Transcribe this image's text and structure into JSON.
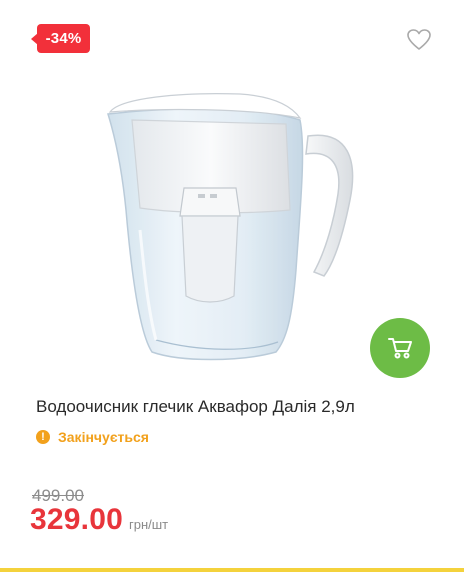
{
  "card": {
    "badge": "-34%",
    "title": "Водоочисник глечик Аквафор Далія 2,9л",
    "status": "Закінчується",
    "old_price": "499.00",
    "price": "329.00",
    "unit": "грн/шт",
    "icons": {
      "favorite": "heart-outline-icon",
      "cart": "cart-icon",
      "status": "exclamation-circle-icon"
    },
    "colors": {
      "badge": "#f2303a",
      "cart_button": "#6dbc46",
      "status": "#f2a11c",
      "price": "#e8353b",
      "bottom_strip": "#f4d23c"
    }
  }
}
